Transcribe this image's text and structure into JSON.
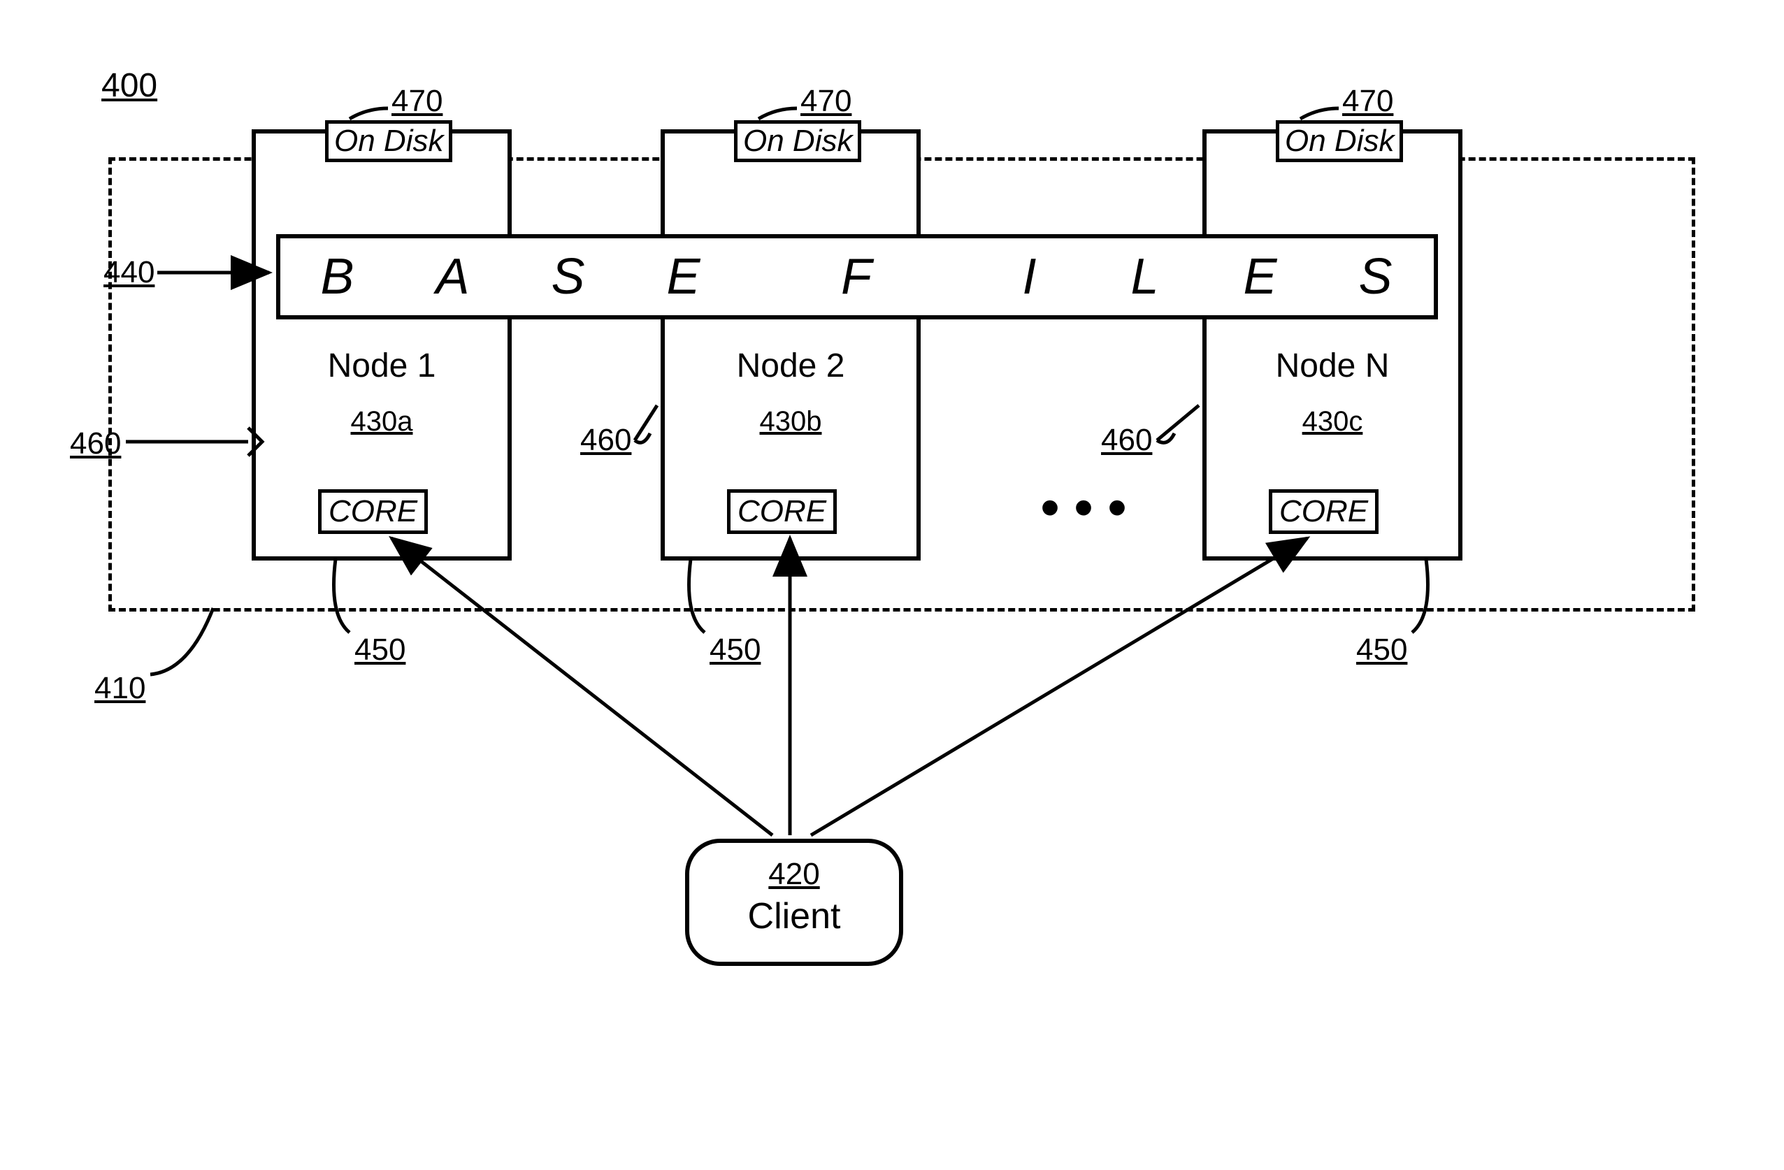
{
  "labels": {
    "ref_400": "400",
    "ref_410": "410",
    "ref_440": "440",
    "ref_460": "460",
    "ref_470": "470",
    "ref_450": "450",
    "ref_420": "420"
  },
  "onDisk": "On Disk",
  "baseFiles": {
    "chars": [
      "B",
      "A",
      "S",
      "E",
      "F",
      "I",
      "L",
      "E",
      "S"
    ]
  },
  "nodes": [
    {
      "title": "Node 1",
      "id": "430a"
    },
    {
      "title": "Node 2",
      "id": "430b"
    },
    {
      "title": "Node N",
      "id": "430c"
    }
  ],
  "core": "CORE",
  "client": {
    "id": "420",
    "label": "Client"
  },
  "dots": "•••"
}
